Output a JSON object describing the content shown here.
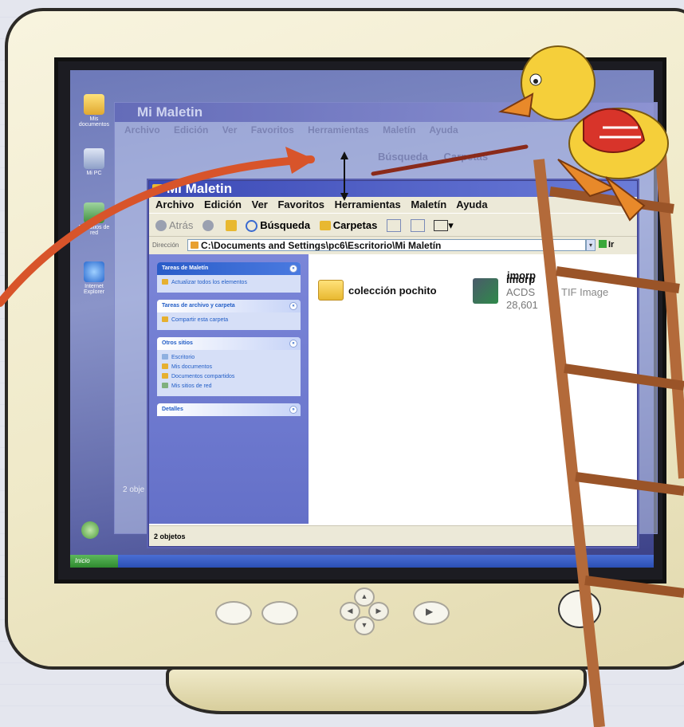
{
  "desktop": {
    "icons": [
      {
        "label": "Mis documentos"
      },
      {
        "label": "Mi PC"
      },
      {
        "label": "Mis sitios de red"
      },
      {
        "label": "Internet Explorer"
      }
    ],
    "start_label": "Inicio"
  },
  "background_window": {
    "title": "Mi Maletin",
    "menu": [
      "Archivo",
      "Edición",
      "Ver",
      "Favoritos",
      "Herramientas",
      "Maletín",
      "Ayuda"
    ],
    "toolbar": [
      "Búsqueda",
      "Carpetas"
    ],
    "status": "2 obje"
  },
  "window": {
    "title": "Mi Maletin",
    "menu": [
      "Archivo",
      "Edición",
      "Ver",
      "Favoritos",
      "Herramientas",
      "Maletín",
      "Ayuda"
    ],
    "toolbar": {
      "back": "Atrás",
      "search": "Búsqueda",
      "folders": "Carpetas"
    },
    "address": {
      "label": "Dirección",
      "path": "C:\\Documents and Settings\\pc6\\Escritorio\\Mi Maletín",
      "go": "Ir"
    },
    "sidebar": {
      "panels": [
        {
          "title": "Tareas de Maletín",
          "items": [
            "Actualizar todos los elementos"
          ]
        },
        {
          "title": "Tareas de archivo y carpeta",
          "items": [
            "Compartir esta carpeta"
          ]
        },
        {
          "title": "Otros sitios",
          "items": [
            "Escritorio",
            "Mis documentos",
            "Documentos compartidos",
            "Mis sitios de red"
          ]
        },
        {
          "title": "Detalles",
          "items": []
        }
      ]
    },
    "files": [
      {
        "name": "colección pochito",
        "type": "folder"
      },
      {
        "name": "imorp",
        "line2": "ACDS",
        "line3": "28,601",
        "type": "image"
      }
    ],
    "status": "2 objetos"
  },
  "overlay_text": {
    "tif_image": "TIF Image"
  },
  "colors": {
    "titlebar": "#3b49b6",
    "sidebar": "#6470c8",
    "arrow": "#d8542a",
    "ladder": "#b36a3a",
    "duck": "#f5cf3a"
  }
}
